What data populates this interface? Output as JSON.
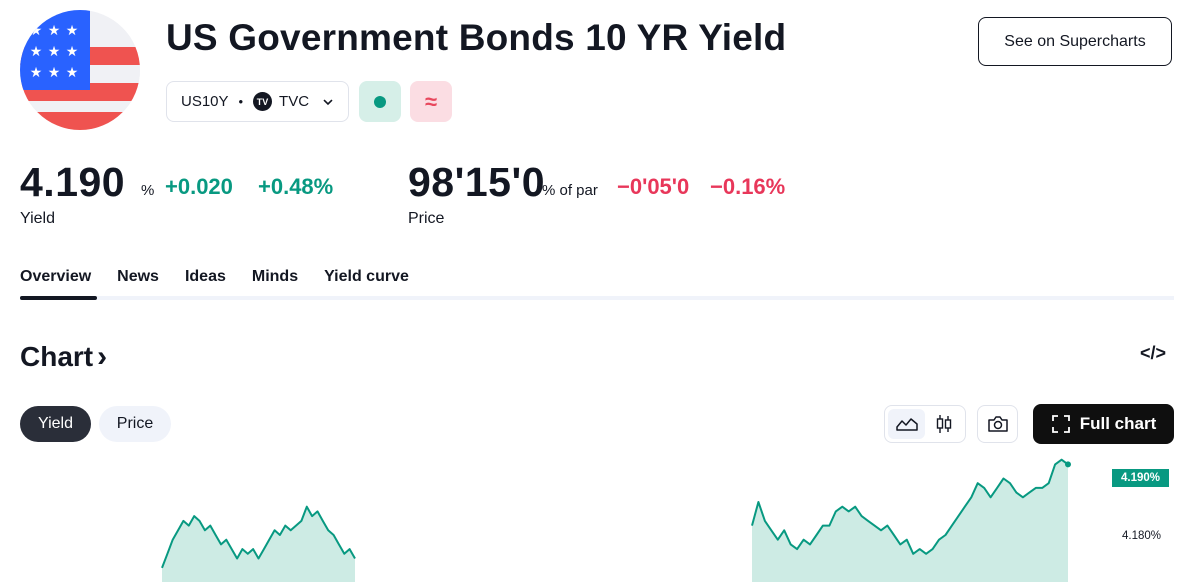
{
  "header": {
    "title": "US Government Bonds 10 YR Yield",
    "flag_icon": "us-flag-icon",
    "supercharts_button": "See on Supercharts",
    "symbol": "US10Y",
    "separator": "•",
    "exchange_logo_text": "TV",
    "exchange": "TVC",
    "market_status": "open",
    "volatility_symbol": "≈"
  },
  "quote": {
    "yield": {
      "value": "4.190",
      "unit": "%",
      "change": "+0.020",
      "change_percent": "+0.48%",
      "label": "Yield"
    },
    "price": {
      "value": "98'15'0",
      "unit": "% of par",
      "change": "−0'05'0",
      "change_percent": "−0.16%",
      "label": "Price"
    }
  },
  "tabs": [
    "Overview",
    "News",
    "Ideas",
    "Minds",
    "Yield curve"
  ],
  "active_tab": "Overview",
  "chart_section": {
    "heading": "Chart",
    "heading_chevron": "›",
    "embed_icon": "</>",
    "toggle": [
      "Yield",
      "Price"
    ],
    "active_toggle": "Yield",
    "full_chart_label": "Full chart"
  },
  "chart_data": {
    "type": "area",
    "ylabel": "",
    "y_axis_ticks": [
      "4.190%",
      "4.180%"
    ],
    "last_value_label": "4.190%",
    "last_value": 4.19,
    "series_color": "#089981",
    "fill_color": "#cdebe4",
    "values": [
      4.168,
      4.171,
      4.174,
      4.176,
      4.178,
      4.177,
      4.179,
      4.178,
      4.176,
      4.177,
      4.175,
      4.173,
      4.174,
      4.172,
      4.17,
      4.172,
      4.171,
      4.172,
      4.17,
      4.172,
      4.174,
      4.176,
      4.175,
      4.177,
      4.176,
      4.177,
      4.178,
      4.181,
      4.179,
      4.18,
      4.178,
      4.176,
      4.175,
      4.173,
      4.171,
      4.172,
      4.17,
      4.177,
      4.182,
      4.178,
      4.176,
      4.174,
      4.176,
      4.173,
      4.172,
      4.174,
      4.173,
      4.175,
      4.177,
      4.177,
      4.18,
      4.181,
      4.18,
      4.181,
      4.179,
      4.178,
      4.177,
      4.176,
      4.177,
      4.175,
      4.173,
      4.174,
      4.171,
      4.172,
      4.171,
      4.172,
      4.174,
      4.175,
      4.177,
      4.179,
      4.181,
      4.183,
      4.186,
      4.185,
      4.183,
      4.185,
      4.187,
      4.186,
      4.184,
      4.183,
      4.184,
      4.185,
      4.185,
      4.186,
      4.19,
      4.191,
      4.19
    ]
  }
}
